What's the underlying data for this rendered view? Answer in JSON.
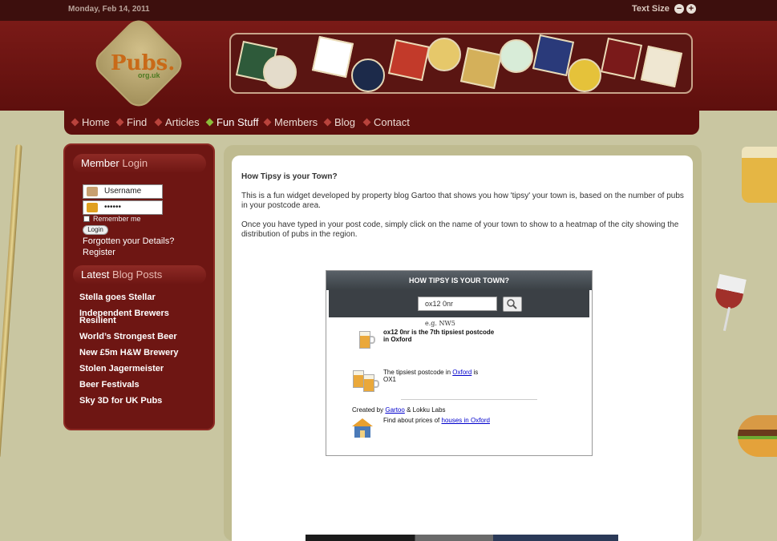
{
  "topbar": {
    "date": "Monday, Feb 14, 2011",
    "text_size_label": "Text Size",
    "decrease_symbol": "−",
    "increase_symbol": "+"
  },
  "logo": {
    "name": "Pubs.",
    "domain": "org.uk"
  },
  "nav": {
    "items": [
      {
        "label": "Home"
      },
      {
        "label": "Find"
      },
      {
        "label": "Articles"
      },
      {
        "label": "Fun Stuff"
      },
      {
        "label": "Members"
      },
      {
        "label": "Blog"
      },
      {
        "label": "Contact"
      }
    ],
    "active_index": 3
  },
  "sidebar": {
    "login_heading_main": "Member",
    "login_heading_accent": "Login",
    "username_placeholder": "Username",
    "password_value": "••••••",
    "remember_label": "Remember me",
    "login_button": "Login",
    "forgotten_link": "Forgotten your Details?",
    "register_link": "Register",
    "posts_heading_main": "Latest",
    "posts_heading_accent": "Blog Posts",
    "posts": [
      {
        "title": "Stella goes Stellar"
      },
      {
        "title": "Independent Brewers Resilient"
      },
      {
        "title": "World’s Strongest Beer"
      },
      {
        "title": "New £5m H&W Brewery"
      },
      {
        "title": "Stolen Jagermeister"
      },
      {
        "title": "Beer Festivals"
      },
      {
        "title": "Sky 3D for UK Pubs"
      }
    ]
  },
  "article": {
    "title": "How Tipsy is your Town?",
    "para1": "This is a fun widget developed by property blog Gartoo that shows you how 'tipsy' your town is, based on the number of pubs in your postcode area.",
    "para2": "Once you have typed in your post code, simply click on the name of your town to show to a heatmap of the city showing the distribution of pubs in the region."
  },
  "widget": {
    "title": "HOW TIPSY IS YOUR TOWN?",
    "search_value": "ox12 0nr",
    "example": "e.g. NW5",
    "result_line1": "ox12 0nr is the 7th tipsiest postcode",
    "result_line2": "in Oxford",
    "tipsiest_prefix": "The tipsiest postcode in",
    "tipsiest_town": "Oxford",
    "tipsiest_suffix": "is",
    "tipsiest_code": "OX1",
    "created_by_prefix": "Created by",
    "created_by_link": "Gartoo",
    "created_by_suffix": "& Lokku Labs",
    "prices_prefix": "Find about prices of",
    "prices_link": "houses in Oxford"
  }
}
